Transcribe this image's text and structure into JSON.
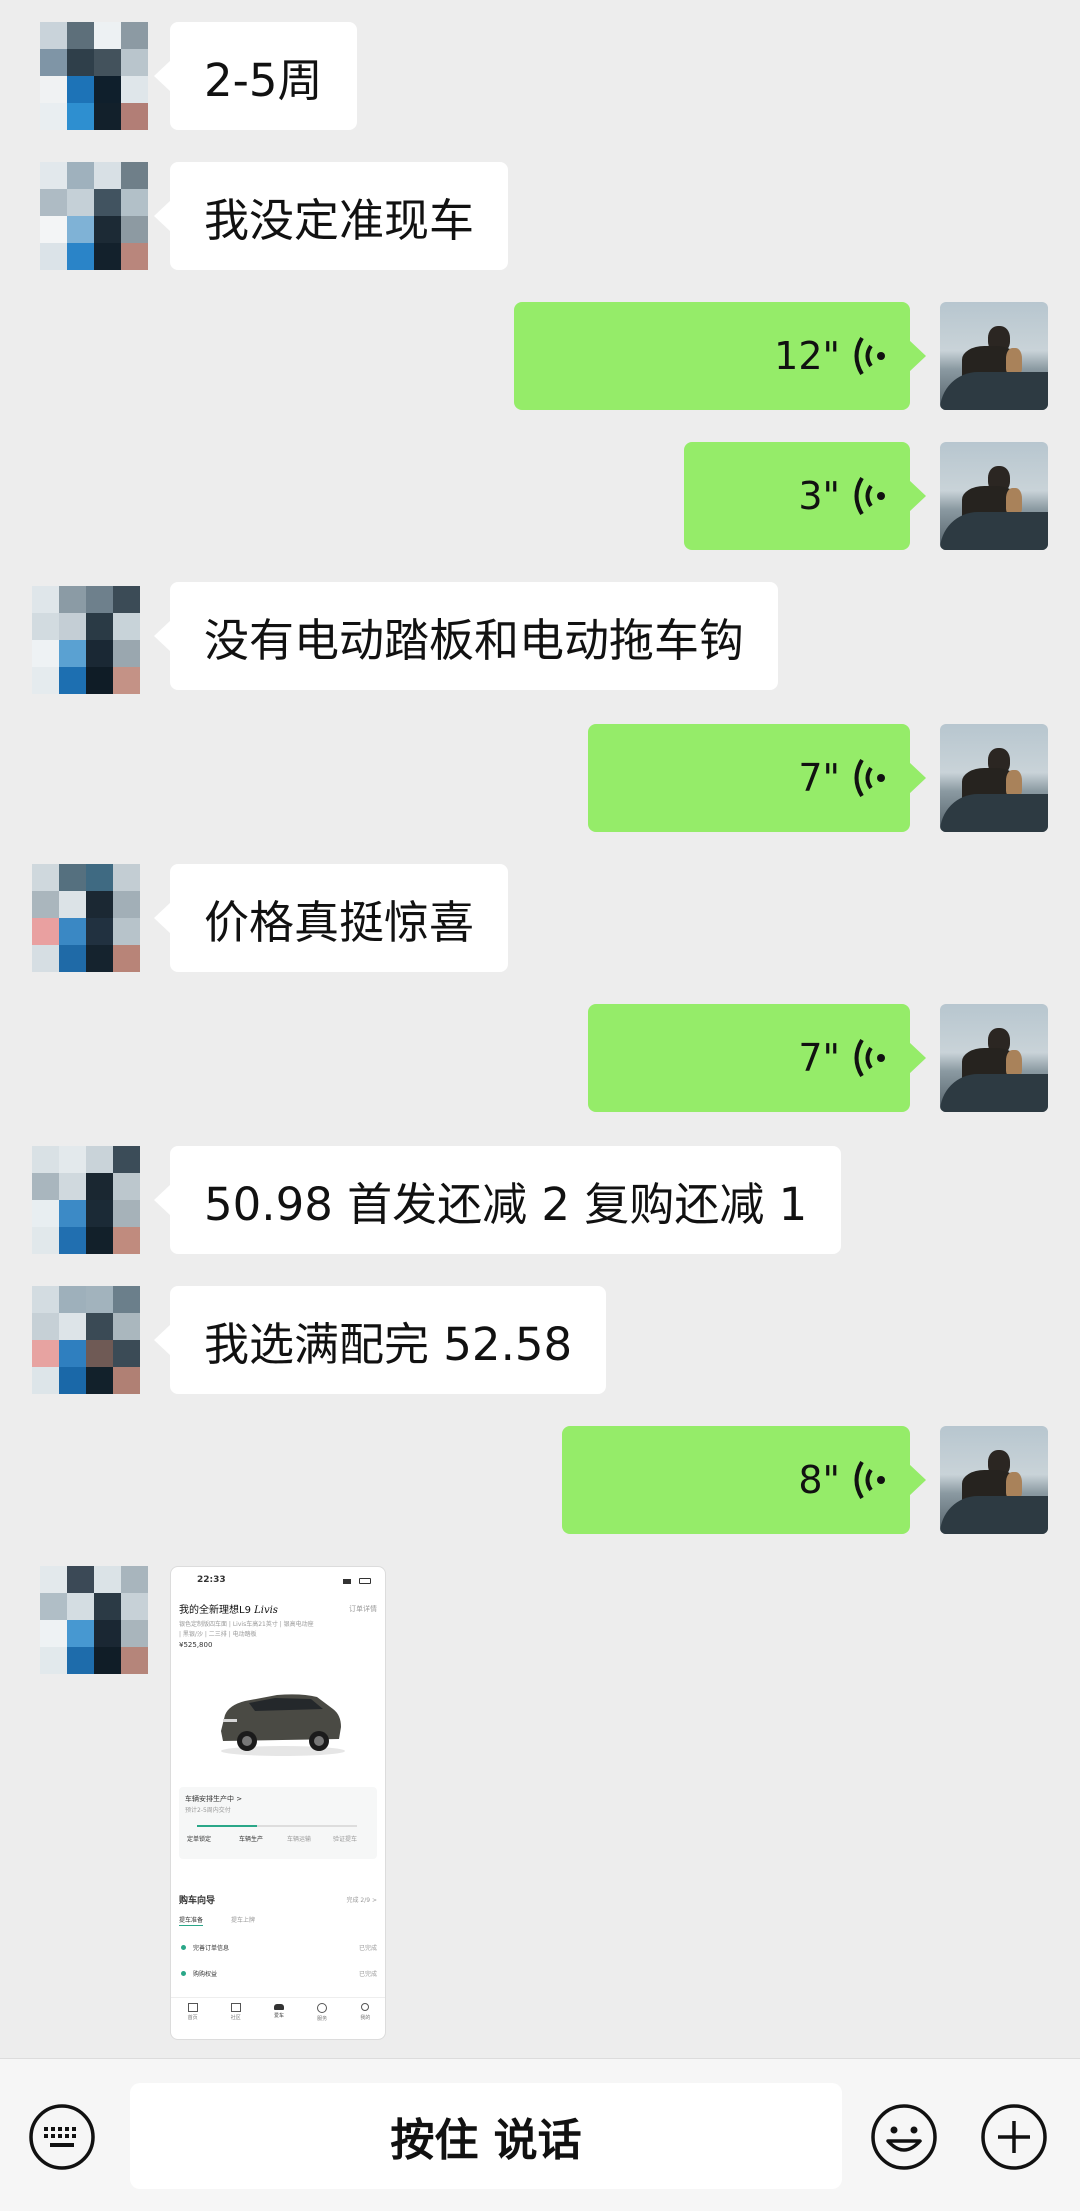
{
  "messages": [
    {
      "side": "left",
      "type": "text",
      "text": "2-5周",
      "avatar": "pixelated-avatar"
    },
    {
      "side": "left",
      "type": "text",
      "text": "我没定准现车",
      "avatar": "pixelated-avatar"
    },
    {
      "side": "right",
      "type": "voice",
      "duration": "12\"",
      "avatar": "photo-avatar"
    },
    {
      "side": "right",
      "type": "voice",
      "duration": "3\"",
      "avatar": "photo-avatar"
    },
    {
      "side": "left",
      "type": "text",
      "text": "没有电动踏板和电动拖车钩",
      "avatar": "pixelated-avatar"
    },
    {
      "side": "right",
      "type": "voice",
      "duration": "7\"",
      "avatar": "photo-avatar"
    },
    {
      "side": "left",
      "type": "text",
      "text": "价格真挺惊喜",
      "avatar": "pixelated-avatar"
    },
    {
      "side": "right",
      "type": "voice",
      "duration": "7\"",
      "avatar": "photo-avatar"
    },
    {
      "side": "left",
      "type": "text",
      "text": "50.98 首发还减 2 复购还减 1",
      "avatar": "pixelated-avatar"
    },
    {
      "side": "left",
      "type": "text",
      "text": "我选满配完 52.58",
      "avatar": "pixelated-avatar"
    },
    {
      "side": "right",
      "type": "voice",
      "duration": "8\"",
      "avatar": "photo-avatar"
    },
    {
      "side": "left",
      "type": "image",
      "avatar": "pixelated-avatar"
    }
  ],
  "image_preview": {
    "time": "22:33",
    "title": "我的全新理想L9",
    "title_script": "Livis",
    "order_link": "订单详情",
    "desc_line1": "银色定制版四车面 | Livis车高21英寸 | 银高电动座",
    "desc_line2": "| 黑银/沙 | 二三排 | 电动踏板",
    "price": "¥525,800",
    "status_title": "车辆安排生产中 >",
    "status_sub": "预计2-5周内交付",
    "progress_steps": [
      "定单锁定",
      "车辆生产",
      "车辆运输",
      "验证提车"
    ],
    "guide_title": "购车向导",
    "guide_right": "完成 2/9 >",
    "guide_tabs": [
      "提车准备",
      "提车上牌"
    ],
    "guide_items": [
      {
        "label": "完善订单信息",
        "status": "已完成"
      },
      {
        "label": "购购权益",
        "status": "已完成"
      }
    ],
    "nav": [
      "首页",
      "社区",
      "爱车",
      "服务",
      "我的"
    ]
  },
  "bottom_bar": {
    "talk_label": "按住 说话",
    "keyboard_icon": "keyboard-icon",
    "emoji_icon": "emoji-icon",
    "plus_icon": "plus-icon"
  },
  "colors": {
    "background": "#ededed",
    "bubble_left": "#ffffff",
    "bubble_right": "#95ec69",
    "bottom_bar": "#f6f6f6"
  }
}
